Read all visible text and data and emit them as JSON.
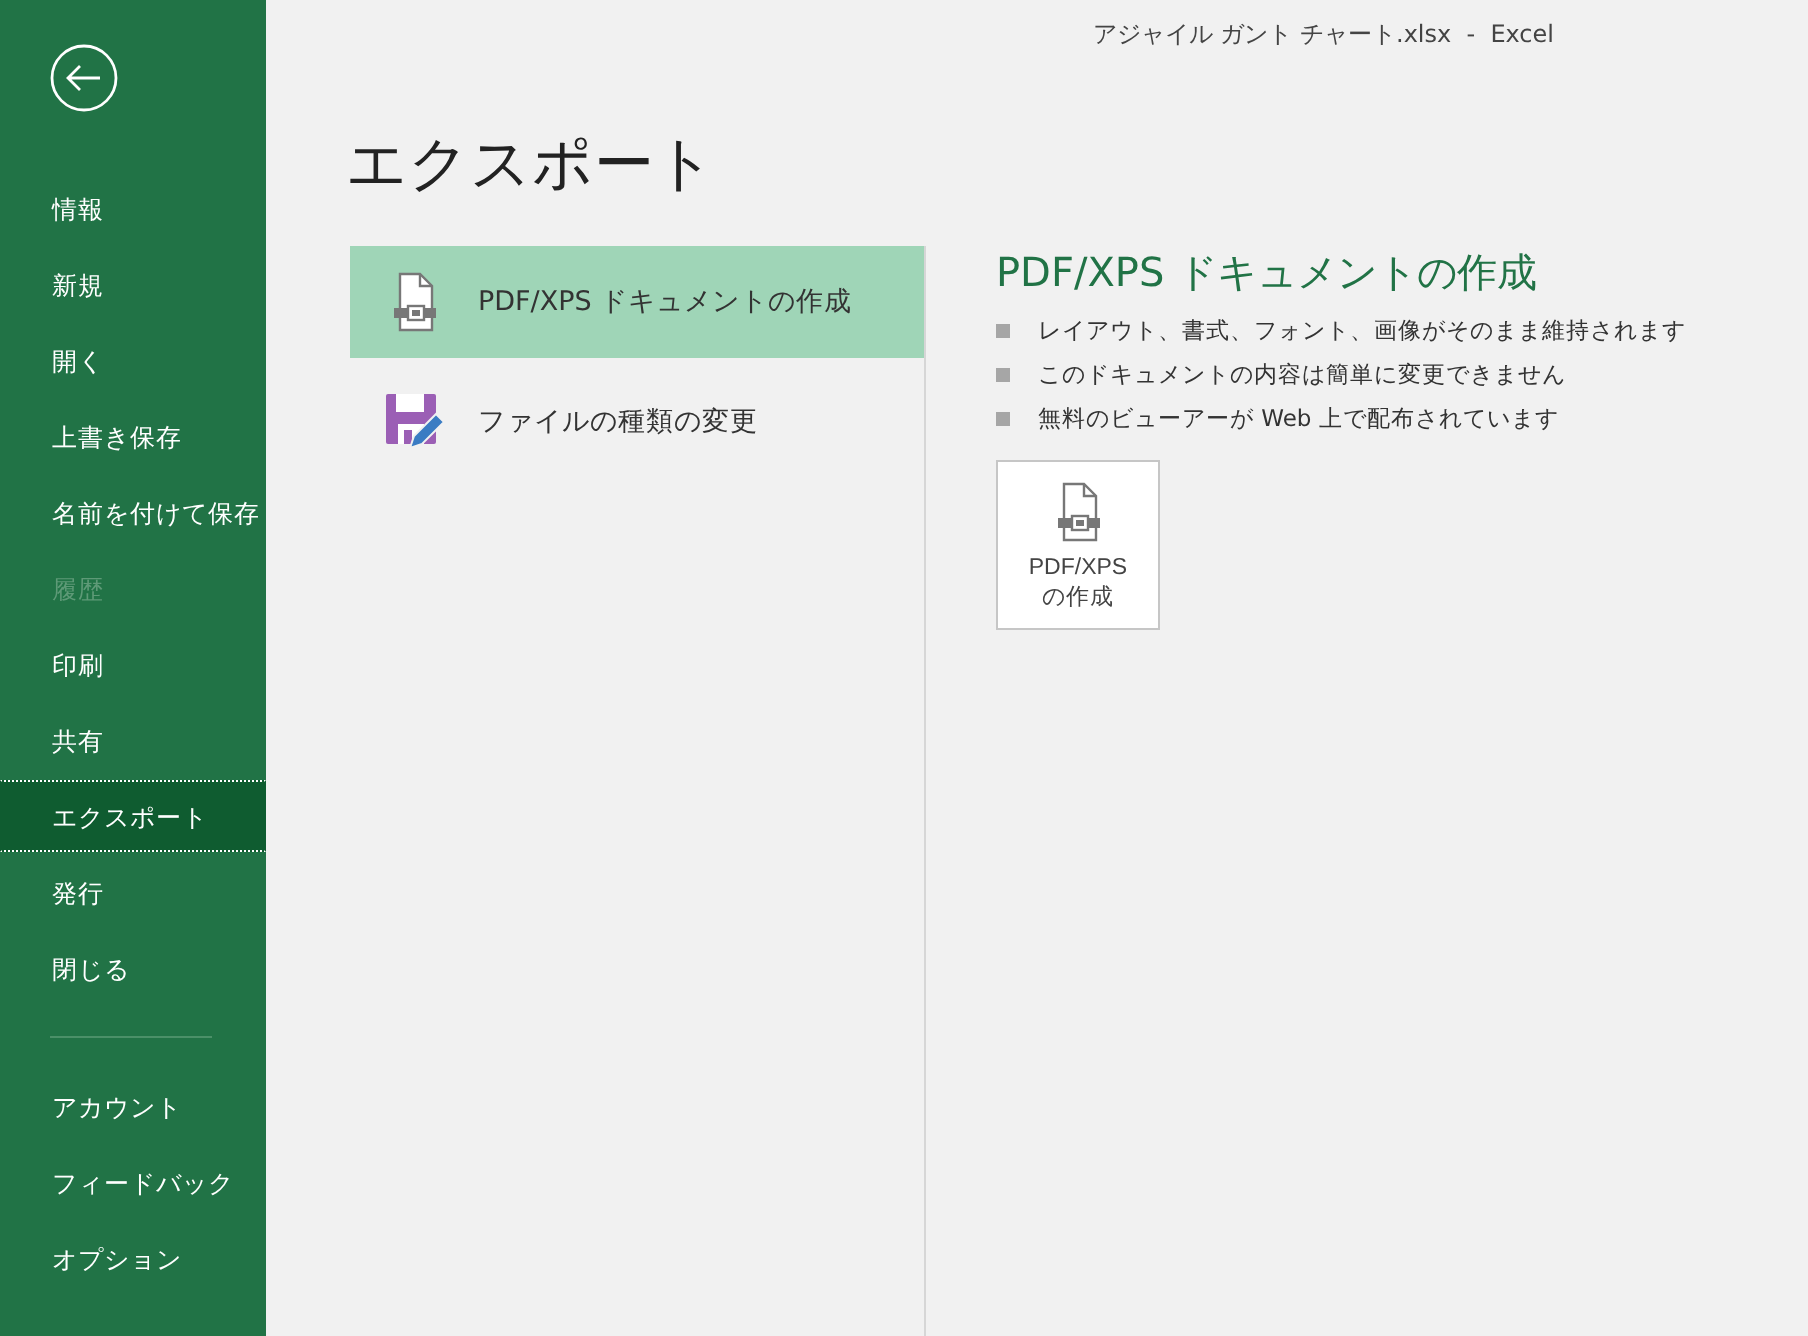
{
  "window": {
    "title": "アジャイル ガント チャート.xlsx  -  Excel"
  },
  "sidebar": {
    "items": [
      {
        "label": "情報",
        "selected": false,
        "disabled": false
      },
      {
        "label": "新規",
        "selected": false,
        "disabled": false
      },
      {
        "label": "開く",
        "selected": false,
        "disabled": false
      },
      {
        "label": "上書き保存",
        "selected": false,
        "disabled": false
      },
      {
        "label": "名前を付けて保存",
        "selected": false,
        "disabled": false
      },
      {
        "label": "履歴",
        "selected": false,
        "disabled": true
      },
      {
        "label": "印刷",
        "selected": false,
        "disabled": false
      },
      {
        "label": "共有",
        "selected": false,
        "disabled": false
      },
      {
        "label": "エクスポート",
        "selected": true,
        "disabled": false
      },
      {
        "label": "発行",
        "selected": false,
        "disabled": false
      },
      {
        "label": "閉じる",
        "selected": false,
        "disabled": false
      }
    ],
    "footer_items": [
      {
        "label": "アカウント",
        "selected": false,
        "disabled": false
      },
      {
        "label": "フィードバック",
        "selected": false,
        "disabled": false
      },
      {
        "label": "オプション",
        "selected": false,
        "disabled": false
      }
    ]
  },
  "page": {
    "heading": "エクスポート",
    "options": [
      {
        "kind": "document",
        "label": "PDF/XPS ドキュメントの作成",
        "selected": true
      },
      {
        "kind": "save",
        "label": "ファイルの種類の変更",
        "selected": false
      }
    ],
    "detail": {
      "title": "PDF/XPS ドキュメントの作成",
      "bullets": [
        "レイアウト、書式、フォント、画像がそのまま維持されます",
        "このドキュメントの内容は簡単に変更できません",
        "無料のビューアーが Web 上で配布されています"
      ],
      "button": [
        "PDF/XPS",
        "の作成"
      ]
    }
  }
}
